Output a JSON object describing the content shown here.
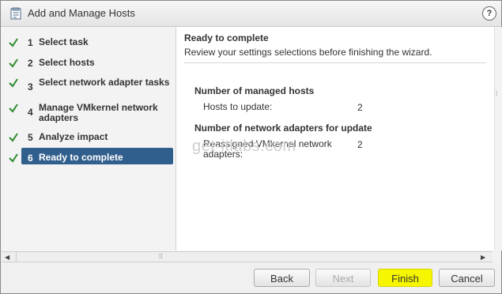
{
  "window": {
    "title": "Add and Manage Hosts",
    "help": "?"
  },
  "steps": [
    {
      "num": "1",
      "label": "Select task",
      "done": true
    },
    {
      "num": "2",
      "label": "Select hosts",
      "done": true
    },
    {
      "num": "3",
      "label": "Select network adapter tasks",
      "done": true
    },
    {
      "num": "4",
      "label": "Manage VMkernel network adapters",
      "done": true
    },
    {
      "num": "5",
      "label": "Analyze impact",
      "done": true
    },
    {
      "num": "6",
      "label": "Ready to complete",
      "done": true,
      "active": true
    }
  ],
  "content": {
    "title": "Ready to complete",
    "subtitle": "Review your settings selections before finishing the wizard.",
    "sections": [
      {
        "heading": "Number of managed hosts",
        "rows": [
          {
            "label": "Hosts to update:",
            "value": "2"
          }
        ]
      },
      {
        "heading": "Number of network adapters for update",
        "rows": [
          {
            "label": "Reassigned VMkernel network adapters:",
            "value": "2"
          }
        ]
      }
    ],
    "watermark": "get-itlabs.com"
  },
  "buttons": {
    "back": "Back",
    "next": "Next",
    "finish": "Finish",
    "cancel": "Cancel"
  },
  "colors": {
    "active_step": "#315f8d",
    "check": "#2e8b2e",
    "finish_highlight": "#f6f600"
  }
}
